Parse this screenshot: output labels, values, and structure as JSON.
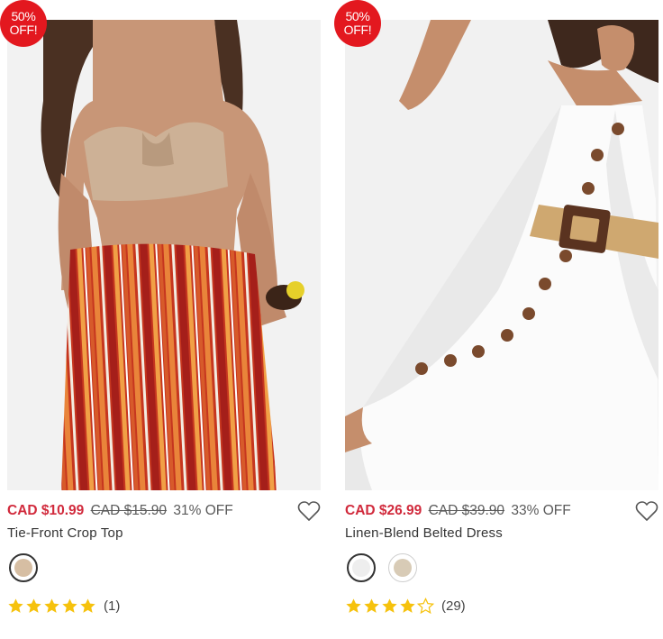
{
  "products": [
    {
      "badge_line1": "50%",
      "badge_line2": "OFF!",
      "price_now": "CAD $10.99",
      "price_was": "CAD $15.90",
      "discount": "31% OFF",
      "name": "Tie-Front Crop Top",
      "swatches": [
        {
          "color": "#d6bea3",
          "selected": true
        }
      ],
      "rating": 5,
      "rating_max": 5,
      "review_count": "(1)"
    },
    {
      "badge_line1": "50%",
      "badge_line2": "OFF!",
      "price_now": "CAD $26.99",
      "price_was": "CAD $39.90",
      "discount": "33% OFF",
      "name": "Linen-Blend Belted Dress",
      "swatches": [
        {
          "color": "#eeeeee",
          "selected": true
        },
        {
          "color": "#d8cbb6",
          "selected": false
        }
      ],
      "rating": 4,
      "rating_max": 5,
      "review_count": "(29)"
    }
  ],
  "colors": {
    "badge": "#e3181f",
    "price_now": "#d12a3c",
    "star": "#f6c20d",
    "heart": "#555555"
  },
  "icons": {
    "wishlist": "heart-outline-icon",
    "rating": "star-icon"
  }
}
